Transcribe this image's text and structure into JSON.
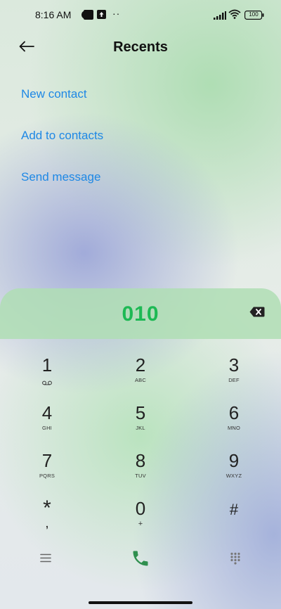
{
  "status_bar": {
    "time": "8:16 AM",
    "more": "··",
    "battery": "100",
    "icons": [
      "app-notification-icon",
      "square-notification-icon",
      "upload-notification-icon",
      "signal-icon",
      "wifi-icon",
      "battery-icon"
    ]
  },
  "header": {
    "title": "Recents",
    "back_icon": "back-arrow-icon"
  },
  "actions": {
    "new_contact": "New contact",
    "add_to_contacts": "Add to contacts",
    "send_message": "Send message"
  },
  "dialer": {
    "number": "010",
    "backspace_icon": "backspace-icon",
    "keys": [
      {
        "digit": "1",
        "letters": ""
      },
      {
        "digit": "2",
        "letters": "ABC"
      },
      {
        "digit": "3",
        "letters": "DEF"
      },
      {
        "digit": "4",
        "letters": "GHI"
      },
      {
        "digit": "5",
        "letters": "JKL"
      },
      {
        "digit": "6",
        "letters": "MNO"
      },
      {
        "digit": "7",
        "letters": "PQRS"
      },
      {
        "digit": "8",
        "letters": "TUV"
      },
      {
        "digit": "9",
        "letters": "WXYZ"
      },
      {
        "digit": "*",
        "letters": ","
      },
      {
        "digit": "0",
        "letters": "+"
      },
      {
        "digit": "#",
        "letters": ""
      }
    ],
    "bottom": {
      "menu_icon": "menu-icon",
      "call_icon": "phone-icon",
      "keypad_icon": "dialpad-grid-icon"
    }
  },
  "colors": {
    "accent_link": "#1e88e5",
    "number_green": "#1db954",
    "call_green": "#2f8f4e"
  }
}
